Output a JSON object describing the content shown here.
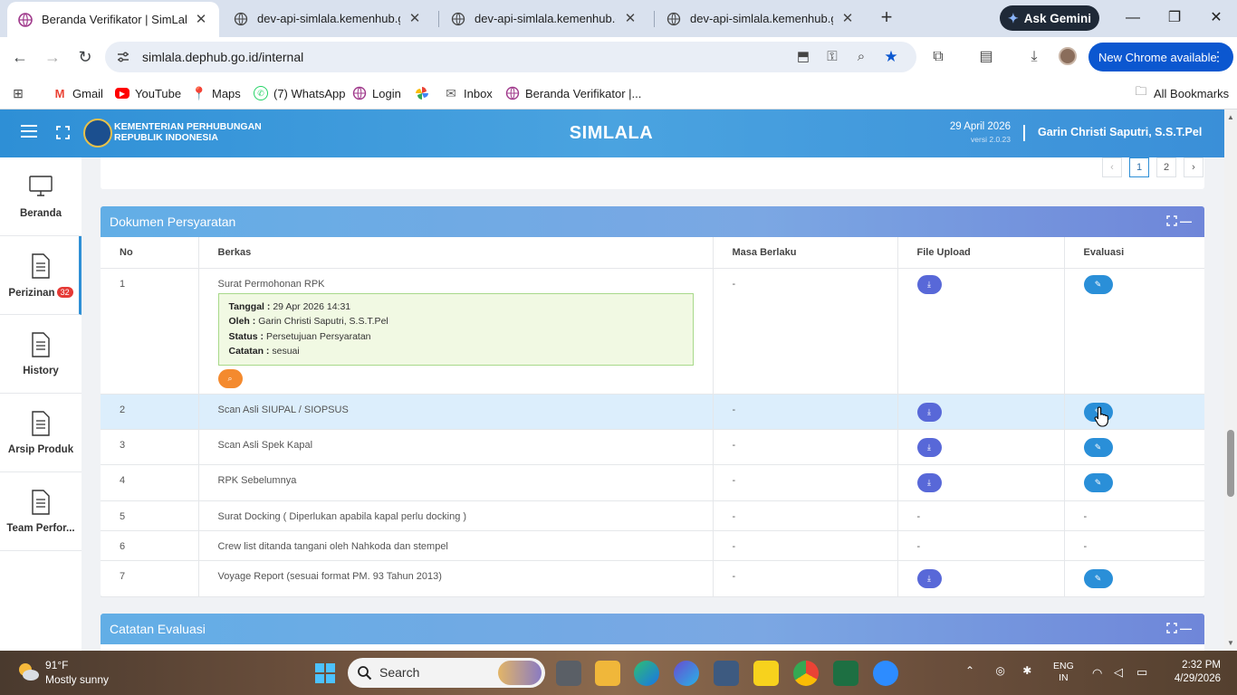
{
  "browser": {
    "tabs": [
      {
        "title": "Beranda Verifikator | SimLala",
        "active": true
      },
      {
        "title": "dev-api-simlala.kemenhub.go.id",
        "active": false
      },
      {
        "title": "dev-api-simlala.kemenhub.go.id",
        "active": false
      },
      {
        "title": "dev-api-simlala.kemenhub.go.id",
        "active": false
      }
    ],
    "ask_gemini": "Ask Gemini",
    "url": "simlala.dephub.go.id/internal",
    "new_chrome": "New Chrome available",
    "bookmarks": [
      {
        "label": "Gmail",
        "icon": "gmail-icon",
        "color": "#ea4335"
      },
      {
        "label": "YouTube",
        "icon": "youtube-icon",
        "color": "#ff0000"
      },
      {
        "label": "Maps",
        "icon": "maps-icon",
        "color": "#34a853"
      },
      {
        "label": "(7) WhatsApp",
        "icon": "whatsapp-icon",
        "color": "#25d366"
      },
      {
        "label": "Login",
        "icon": "login-globe-icon",
        "color": "#a03a8c"
      },
      {
        "label": "",
        "icon": "pinwheel-icon",
        "color": "#fbbc05"
      },
      {
        "label": "Inbox",
        "icon": "mail-icon",
        "color": "#666666"
      },
      {
        "label": "Beranda Verifikator |...",
        "icon": "simlala-globe-icon",
        "color": "#a03a8c"
      }
    ],
    "all_bookmarks": "All Bookmarks"
  },
  "app": {
    "ministry_line1": "KEMENTERIAN PERHUBUNGAN",
    "ministry_line2": "REPUBLIK INDONESIA",
    "title": "SIMLALA",
    "date": "29 April 2026",
    "version": "versi 2.0.23",
    "user": "Garin Christi Saputri, S.S.T.Pel"
  },
  "sidebar": {
    "items": [
      {
        "label": "Beranda",
        "icon": "monitor-icon",
        "badge": ""
      },
      {
        "label": "Perizinan",
        "icon": "document-icon",
        "badge": "32"
      },
      {
        "label": "History",
        "icon": "document-icon",
        "badge": ""
      },
      {
        "label": "Arsip Produk",
        "icon": "document-icon",
        "badge": ""
      },
      {
        "label": "Team Perfor...",
        "icon": "document-icon",
        "badge": ""
      }
    ]
  },
  "pagination": {
    "prev": "‹",
    "pages": [
      "1",
      "2"
    ],
    "current": "1",
    "next": "›"
  },
  "dokumen": {
    "title": "Dokumen Persyaratan",
    "columns": [
      "No",
      "Berkas",
      "Masa Berlaku",
      "File Upload",
      "Evaluasi"
    ],
    "rows": [
      {
        "no": "1",
        "berkas": "Surat Permohonan RPK",
        "masa": "-",
        "upload": true,
        "eval": true,
        "detail": {
          "tanggal_label": "Tanggal :",
          "tanggal": "29 Apr 2026 14:31",
          "oleh_label": "Oleh :",
          "oleh": "Garin Christi Saputri, S.S.T.Pel",
          "status_label": "Status :",
          "status": "Persetujuan Persyaratan",
          "catatan_label": "Catatan :",
          "catatan": "sesuai"
        }
      },
      {
        "no": "2",
        "berkas": "Scan Asli SIUPAL / SIOPSUS",
        "masa": "-",
        "upload": true,
        "eval": true,
        "highlight": true
      },
      {
        "no": "3",
        "berkas": "Scan Asli Spek Kapal",
        "masa": "-",
        "upload": true,
        "eval": true
      },
      {
        "no": "4",
        "berkas": "RPK Sebelumnya",
        "masa": "-",
        "upload": true,
        "eval": true
      },
      {
        "no": "5",
        "berkas": "Surat Docking ( Diperlukan apabila kapal perlu docking )",
        "masa": "-",
        "upload_text": "-",
        "eval_text": "-"
      },
      {
        "no": "6",
        "berkas": "Crew list ditanda tangani oleh Nahkoda dan stempel",
        "masa": "-",
        "upload_text": "-",
        "eval_text": "-"
      },
      {
        "no": "7",
        "berkas": "Voyage Report (sesuai format PM. 93 Tahun 2013)",
        "masa": "-",
        "upload": true,
        "eval": true
      }
    ]
  },
  "catatan": {
    "title": "Catatan Evaluasi"
  },
  "taskbar": {
    "temp": "91°F",
    "weather": "Mostly sunny",
    "search": "Search",
    "lang1": "ENG",
    "lang2": "IN",
    "time": "2:32 PM",
    "date": "4/29/2026"
  }
}
